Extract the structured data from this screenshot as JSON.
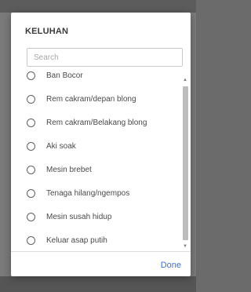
{
  "dialog": {
    "title": "KELUHAN",
    "search_placeholder": "Search",
    "search_value": "",
    "options": [
      {
        "label": "Ban Bocor",
        "selected": false
      },
      {
        "label": "Rem cakram/depan blong",
        "selected": false
      },
      {
        "label": "Rem cakram/Belakang blong",
        "selected": false
      },
      {
        "label": "Aki soak",
        "selected": false
      },
      {
        "label": "Mesin brebet",
        "selected": false
      },
      {
        "label": "Tenaga hilang/ngempos",
        "selected": false
      },
      {
        "label": "Mesin susah hidup",
        "selected": false
      },
      {
        "label": "Keluar asap putih",
        "selected": false
      }
    ],
    "done_label": "Done"
  },
  "colors": {
    "accent": "#3f6fd6",
    "backdrop": "#7a7a7a"
  },
  "icons": {
    "scroll_up": "up-arrow-icon",
    "scroll_down": "down-arrow-icon",
    "radio": "radio-unchecked-icon"
  }
}
